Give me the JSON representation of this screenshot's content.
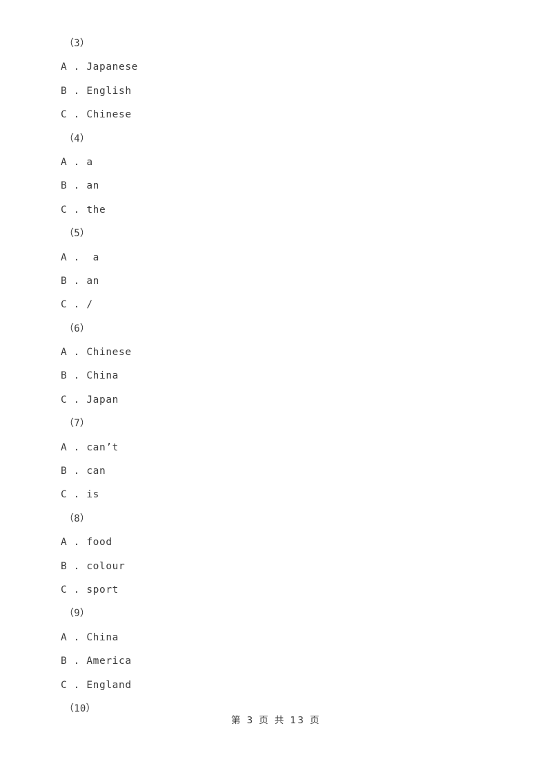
{
  "document": {
    "page_label": "第 3 页 共 13 页",
    "text_color": "#3b3b3b",
    "background_color": "#ffffff"
  },
  "questions": [
    {
      "number": "（3）",
      "options": [
        {
          "letter": "A",
          "sep": " . ",
          "text": "Japanese"
        },
        {
          "letter": "B",
          "sep": " . ",
          "text": "English"
        },
        {
          "letter": "C",
          "sep": " . ",
          "text": "Chinese"
        }
      ]
    },
    {
      "number": "（4）",
      "options": [
        {
          "letter": "A",
          "sep": " . ",
          "text": "a"
        },
        {
          "letter": "B",
          "sep": " . ",
          "text": "an"
        },
        {
          "letter": "C",
          "sep": " . ",
          "text": "the"
        }
      ]
    },
    {
      "number": "（5）",
      "options": [
        {
          "letter": "A",
          "sep": " .  ",
          "text": "a"
        },
        {
          "letter": "B",
          "sep": " . ",
          "text": "an"
        },
        {
          "letter": "C",
          "sep": " . ",
          "text": "/"
        }
      ]
    },
    {
      "number": "（6）",
      "options": [
        {
          "letter": "A",
          "sep": " . ",
          "text": "Chinese"
        },
        {
          "letter": "B",
          "sep": " . ",
          "text": "China"
        },
        {
          "letter": "C",
          "sep": " . ",
          "text": "Japan"
        }
      ]
    },
    {
      "number": "（7）",
      "options": [
        {
          "letter": "A",
          "sep": " . ",
          "text": "can’t"
        },
        {
          "letter": "B",
          "sep": " . ",
          "text": "can"
        },
        {
          "letter": "C",
          "sep": " . ",
          "text": "is"
        }
      ]
    },
    {
      "number": "（8）",
      "options": [
        {
          "letter": "A",
          "sep": " . ",
          "text": "food"
        },
        {
          "letter": "B",
          "sep": " . ",
          "text": "colour"
        },
        {
          "letter": "C",
          "sep": " . ",
          "text": "sport"
        }
      ]
    },
    {
      "number": "（9）",
      "options": [
        {
          "letter": "A",
          "sep": " . ",
          "text": "China"
        },
        {
          "letter": "B",
          "sep": " . ",
          "text": "America"
        },
        {
          "letter": "C",
          "sep": " . ",
          "text": "England"
        }
      ]
    },
    {
      "number": "（10）",
      "options": []
    }
  ]
}
